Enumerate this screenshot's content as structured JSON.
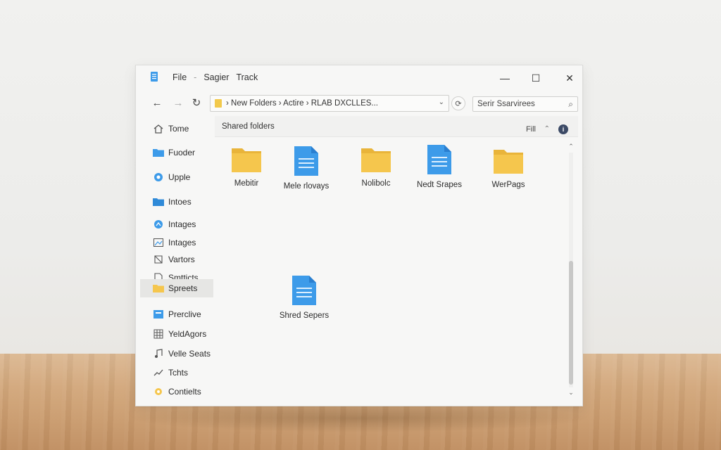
{
  "window": {
    "menu": [
      "File",
      "-",
      "Sagier",
      "Track"
    ],
    "controls": {
      "minimize": "—",
      "maximize": "☐",
      "close": "✕"
    }
  },
  "nav": {
    "back": "←",
    "forward": "→",
    "refresh": "↻",
    "address_text": "› New Folders  ›  Actire  ›  RLAB DXCLLES...",
    "address_dropdown": "⌄",
    "search_placeholder": "Serir Ssarvirees"
  },
  "sidebar": {
    "items": [
      {
        "label": "Tome",
        "icon": "home-icon"
      },
      {
        "label": "Fuoder",
        "icon": "folder-icon"
      },
      {
        "label": "Upple",
        "icon": "cloud-icon"
      },
      {
        "label": "Intoes",
        "icon": "folder-icon"
      },
      {
        "label": "Intages",
        "icon": "pictures-icon"
      },
      {
        "label": "Intages",
        "icon": "image-icon"
      },
      {
        "label": "Vartors",
        "icon": "vector-icon"
      },
      {
        "label": "Smtticts",
        "icon": "document-icon"
      },
      {
        "label": "Spreets",
        "icon": "folder-icon"
      },
      {
        "label": "Prerclive",
        "icon": "preview-icon"
      },
      {
        "label": "YeldAgors",
        "icon": "grid-icon"
      },
      {
        "label": "Velle Seats",
        "icon": "music-icon"
      },
      {
        "label": "Tchts",
        "icon": "chart-icon"
      },
      {
        "label": "Contielts",
        "icon": "settings-icon"
      }
    ],
    "active_index": 8
  },
  "content": {
    "header_title": "Shared folders",
    "header_fill": "Fill",
    "header_sort": "⌃",
    "header_info": "i",
    "items": [
      {
        "label": "Mebitir",
        "type": "folder"
      },
      {
        "label": "Mele rlovays",
        "type": "document"
      },
      {
        "label": "Nolibolc",
        "type": "folder"
      },
      {
        "label": "Nedt Srapes",
        "type": "document"
      },
      {
        "label": "WerPags",
        "type": "folder"
      },
      {
        "label": "Shred Sepers",
        "type": "document"
      }
    ]
  },
  "colors": {
    "folder": "#f5c64d",
    "folder_dark": "#e9b43a",
    "document": "#3d9be9",
    "document_dark": "#2a7fd0",
    "window_bg": "#f7f7f6"
  }
}
